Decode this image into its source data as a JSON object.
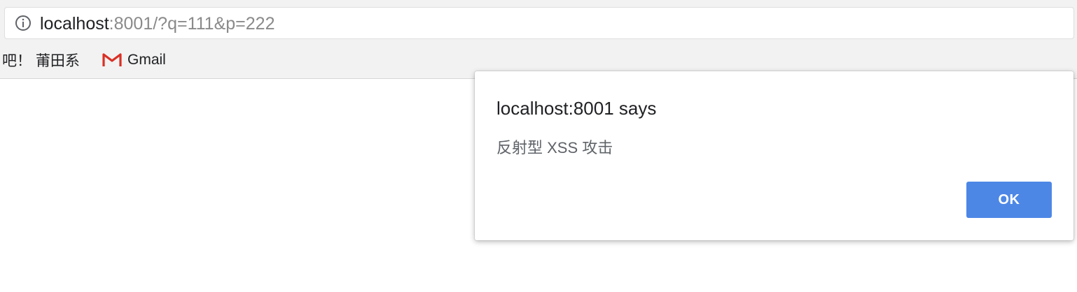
{
  "address_bar": {
    "icon": "info-icon",
    "url_host": "localhost",
    "url_rest": ":8001/?q=111&p=222"
  },
  "bookmarks": [
    {
      "label": "吧！ 莆田系"
    },
    {
      "label": "Gmail",
      "icon": "gmail-icon"
    }
  ],
  "alert_dialog": {
    "title": "localhost:8001 says",
    "message": "反射型 XSS 攻击",
    "ok_label": "OK"
  },
  "colors": {
    "ok_button": "#4d87e6",
    "gmail_red": "#d93025"
  }
}
